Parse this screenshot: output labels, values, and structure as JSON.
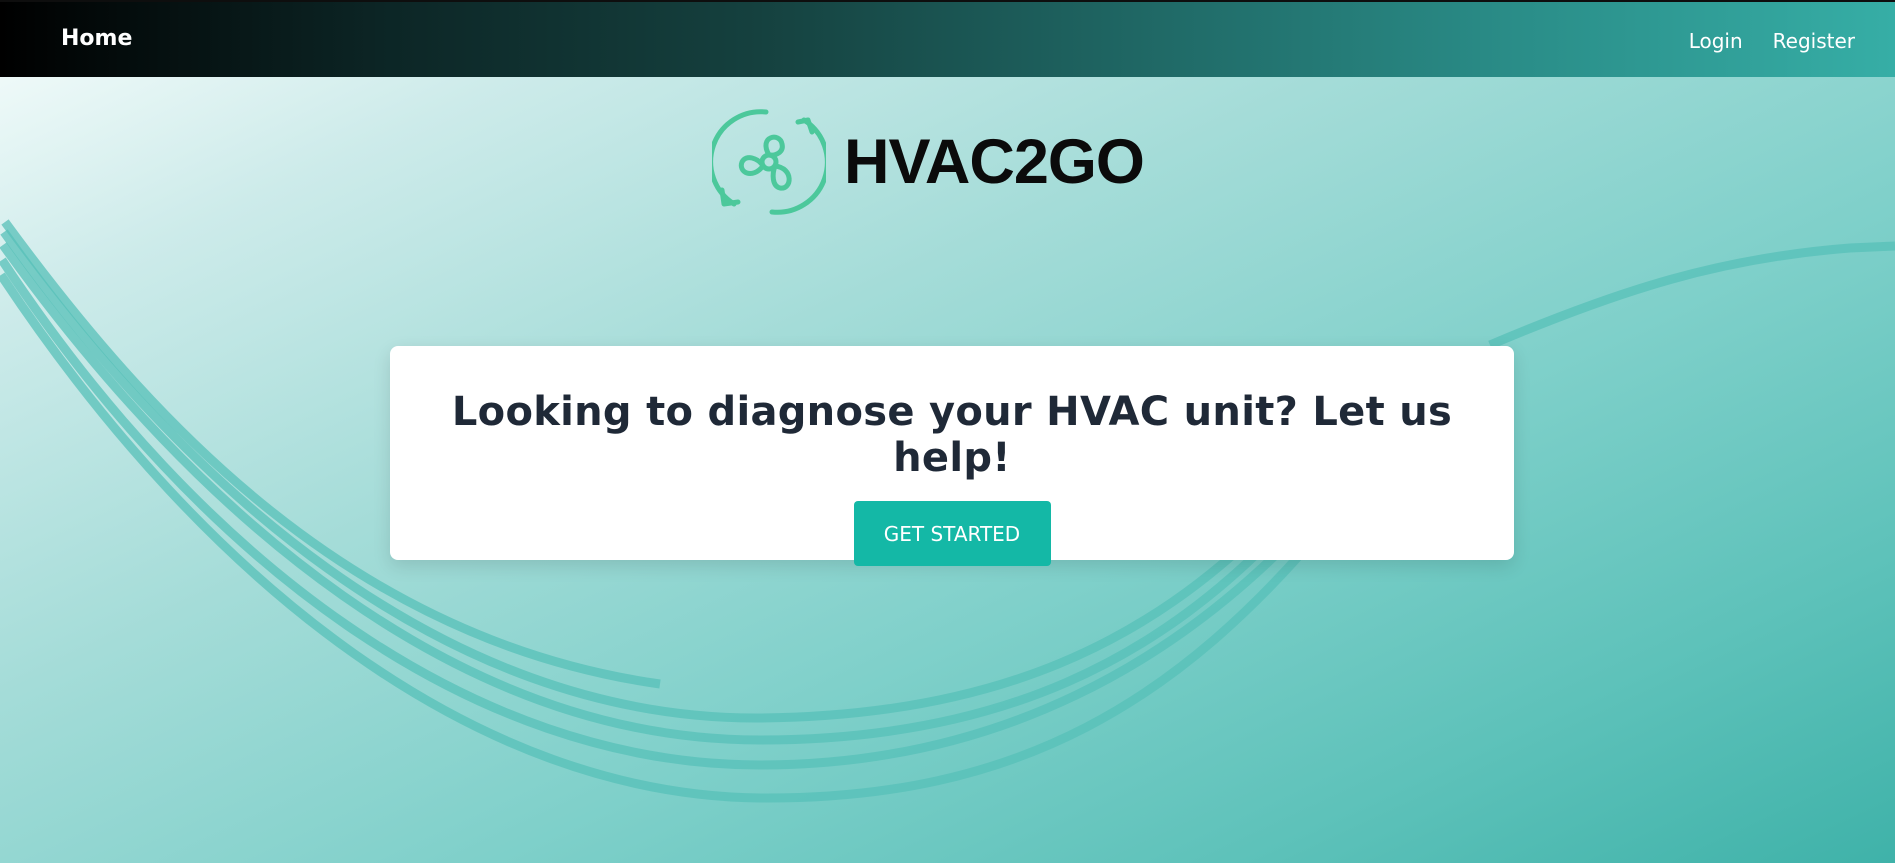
{
  "nav": {
    "home_label": "Home",
    "login_label": "Login",
    "register_label": "Register"
  },
  "logo": {
    "icon": "fan-recycle-icon",
    "text": "HVAC2GO",
    "icon_color": "#4cc89b"
  },
  "hero": {
    "title": "Looking to diagnose your HVAC unit? Let us help!",
    "button_label": "GET STARTED",
    "button_color": "#14b8a6"
  },
  "decoration": {
    "swoosh_color": "#57c0b8"
  }
}
